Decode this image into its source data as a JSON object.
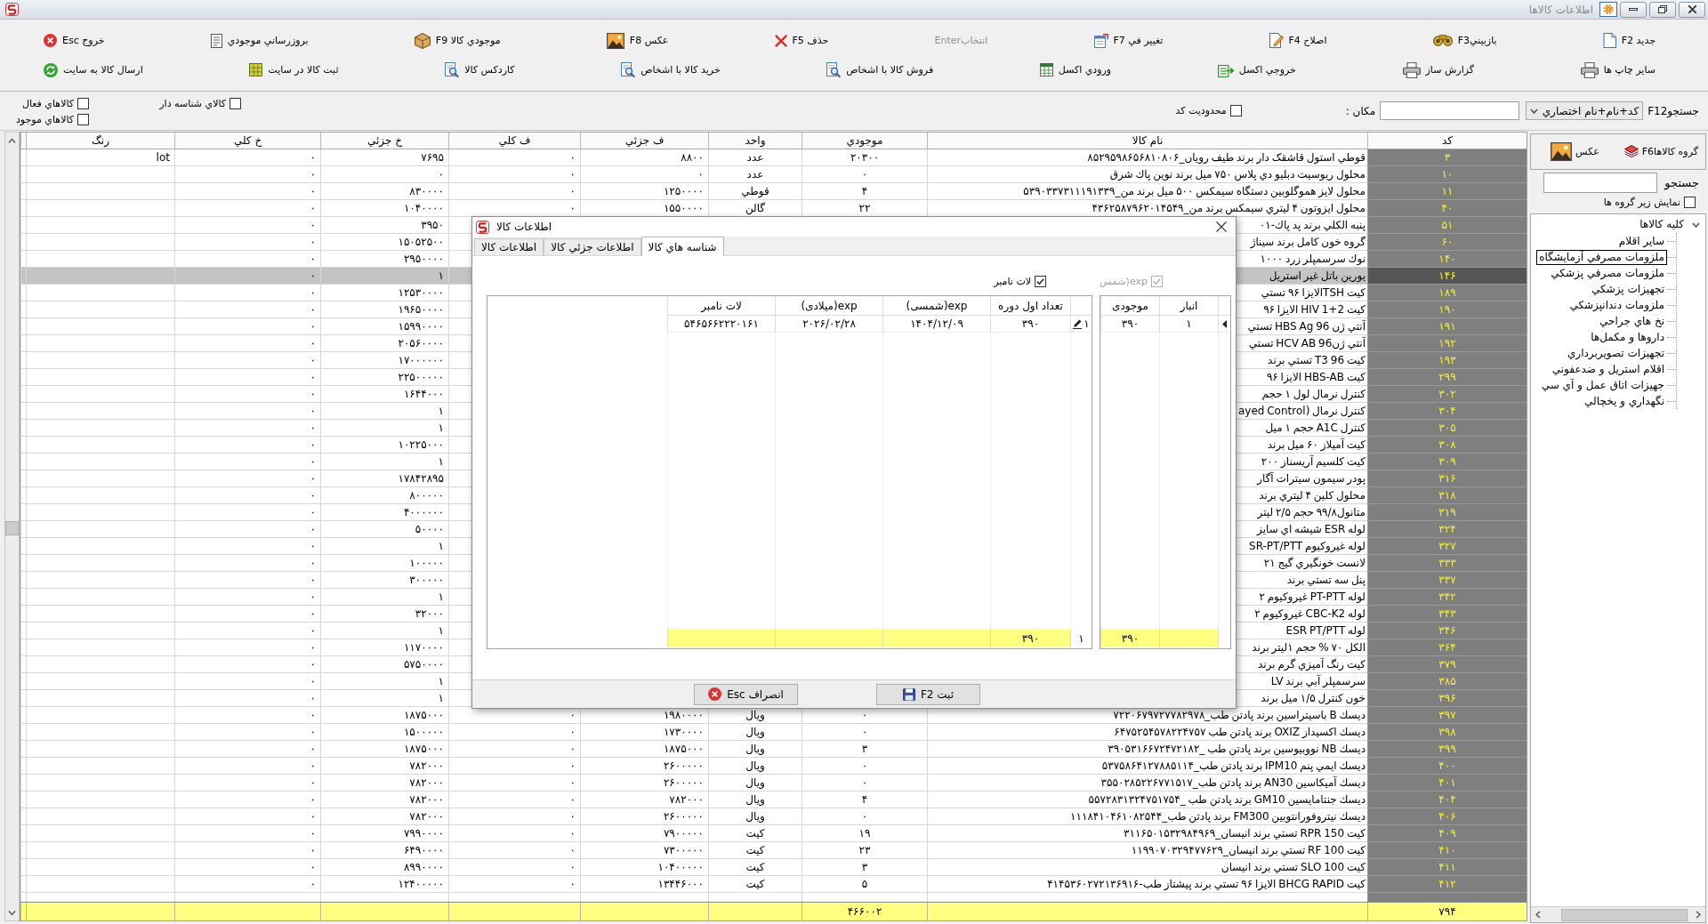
{
  "window": {
    "title": "اطلاعات كالاها"
  },
  "toolbar": {
    "top": [
      {
        "label": "جديد F2",
        "disabled": false
      },
      {
        "label": "بازبينيF3",
        "disabled": false
      },
      {
        "label": "اصلاح F4",
        "disabled": false
      },
      {
        "label": "تغيير في F7",
        "disabled": false
      },
      {
        "label": "انتخابEnter",
        "disabled": true
      },
      {
        "label": "حذف F5",
        "disabled": false
      },
      {
        "label": "عكس F8",
        "disabled": false
      },
      {
        "label": "موجودي كالا F9",
        "disabled": false
      },
      {
        "label": "بروزرساني موجودي",
        "disabled": false
      },
      {
        "label": "خروج Esc",
        "disabled": false
      }
    ],
    "bottom": [
      {
        "label": "ساير چاپ ها",
        "disabled": false
      },
      {
        "label": "گزارش ساز",
        "disabled": false
      },
      {
        "label": "خروجي اكسل",
        "disabled": false
      },
      {
        "label": "ورودي اكسل",
        "disabled": false
      },
      {
        "label": "فروش كالا با اشخاص",
        "disabled": false
      },
      {
        "label": "خريد كالا با اشخاص",
        "disabled": false
      },
      {
        "label": "كاردكس كالا",
        "disabled": false
      },
      {
        "label": "ثبت كالا در سايت",
        "disabled": false
      },
      {
        "label": "ارسال كالا به سايت",
        "disabled": false
      }
    ]
  },
  "filters": {
    "search_label": "جستجوF12",
    "search_mode": "كد+نام+نام اختصاري",
    "location_label": "مكان :",
    "code_limit": {
      "label": "محدوديت كد",
      "checked": false
    },
    "options": [
      {
        "label": "كالاي شناسه دار",
        "checked": false
      },
      {
        "label": "كالاهاي فعال",
        "checked": false
      },
      {
        "label": "كالاهاي موجود",
        "checked": false
      }
    ]
  },
  "table": {
    "columns": [
      "كد",
      "نام كالا",
      "موجودي",
      "واحد",
      "ف جزئي",
      "ف كلي",
      "خ جزئي",
      "خ كلي",
      "رنگ"
    ],
    "rows": [
      {
        "kod": "۳",
        "name": "قوطي استول قاشقک دار برند طيف رويان_۸۵۲۹۵۹۸۶۵۶۸۱۰۸۰۶",
        "stock": "۲۰۳۰۰",
        "unit": "عدد",
        "sell_retail": "۸۸۰۰",
        "sell_bulk": "۰",
        "buy_retail": "۷۶۹۵",
        "buy_bulk": "۰",
        "shade": "lot",
        "selected": false
      },
      {
        "kod": "۱۰",
        "name": "محلول ريوسيت دبليو دي پلاس  ۷۵۰ ميل برند نوين پاك شرق",
        "stock": "۰",
        "unit": "عدد",
        "sell_retail": "۰",
        "sell_bulk": "۰",
        "buy_retail": "۰",
        "buy_bulk": "۰",
        "selected": false
      },
      {
        "kod": "۱۱",
        "name": "محلول لايز هموگلوبين دستگاه سيمكس ۵۰۰ ميل برند من_۵۳۹۰۳۳۷۳۱۱۱۹۱۳۳۹",
        "stock": "۴",
        "unit": "قوطي",
        "sell_retail": "۱۲۵۰۰۰۰",
        "sell_bulk": "۰",
        "buy_retail": "۸۳۰۰۰۰",
        "buy_bulk": "۰",
        "selected": false
      },
      {
        "kod": "۴۰",
        "name": "محلول ايزوتون ۴ ليتري سيمكس برند من_۴۳۶۲۵۸۷۹۶۲۰۱۴۵۴۹",
        "stock": "۲۲",
        "unit": "گالن",
        "sell_retail": "۱۵۵۰۰۰۰",
        "sell_bulk": "۰",
        "buy_retail": "۱۰۴۰۰۰۰",
        "buy_bulk": "۰",
        "selected": false
      },
      {
        "kod": "۵۱",
        "name": "پنبه الكلي برند پد پاك-۰۱",
        "buy_retail": "۳۹۵۰",
        "buy_bulk": "۰",
        "selected": false
      },
      {
        "kod": "۶۰",
        "name": "گروه خون كامل برند سيناژ",
        "buy_retail": "۱۵۰۵۲۵۰۰",
        "buy_bulk": "۰",
        "selected": false
      },
      {
        "kod": "۱۴۰",
        "name": "نوك سرسمپلر زرد ۱۰۰۰",
        "buy_retail": "۲۹۵۰۰۰۰",
        "buy_bulk": "۰",
        "selected": false
      },
      {
        "kod": "۱۴۶",
        "name": "يورين باتل غير استريل",
        "buy_retail": "۱",
        "buy_bulk": "۰",
        "selected": true
      },
      {
        "kod": "۱۸۹",
        "name": "كيت TSHالايزا ۹۶ تستي",
        "buy_retail": "۱۲۵۳۰۰۰۰",
        "buy_bulk": "۰",
        "selected": false
      },
      {
        "kod": "۱۹۰",
        "name": "كيت HIV 1+2 الايزا ۹۶",
        "buy_retail": "۱۹۶۵۰۰۰۰",
        "buy_bulk": "۰",
        "selected": false
      },
      {
        "kod": "۱۹۱",
        "name": "آنتي ژن HBS Ag 96 تستي",
        "buy_retail": "۱۵۹۹۰۰۰۰",
        "buy_bulk": "۰",
        "selected": false
      },
      {
        "kod": "۱۹۲",
        "name": "آنتي ژنHCV AB 96 تستي",
        "buy_retail": "۲۰۵۶۰۰۰۰",
        "buy_bulk": "۰",
        "selected": false
      },
      {
        "kod": "۱۹۳",
        "name": "كيت T3 96 تستي برند",
        "buy_retail": "۱۷۰۰۰۰۰۰",
        "buy_bulk": "۰",
        "selected": false
      },
      {
        "kod": "۲۹۹",
        "name": "كيت HBS-AB الايزا ۹۶",
        "buy_retail": "۲۲۵۰۰۰۰۰",
        "buy_bulk": "۰",
        "selected": false
      },
      {
        "kod": "۳۰۲",
        "name": "كنترل نرمال لول ۱ حجم",
        "buy_retail": "۱۶۴۴۰۰۰",
        "buy_bulk": "۰",
        "selected": false
      },
      {
        "kod": "۳۰۴",
        "name": "كنترل نرمال (ayed Control",
        "buy_retail": "۱",
        "buy_bulk": "۰",
        "selected": false
      },
      {
        "kod": "۳۰۵",
        "name": "كنترل A1C حجم ۱ ميل",
        "buy_retail": "۱",
        "buy_bulk": "۰",
        "selected": false
      },
      {
        "kod": "۳۰۸",
        "name": "كيت آميلاز ۶۰ ميل برند",
        "buy_retail": "۱۰۲۲۵۰۰۰",
        "buy_bulk": "۰",
        "selected": false
      },
      {
        "kod": "۳۰۹",
        "name": "كيت كلسيم آريسناز ۲۰۰",
        "buy_retail": "۱",
        "buy_bulk": "۰",
        "selected": false
      },
      {
        "kod": "۳۱۶",
        "name": "پودر سيمون سيترات آگار",
        "buy_retail": "۱۷۸۴۲۸۹۵",
        "buy_bulk": "۰",
        "selected": false
      },
      {
        "kod": "۳۱۸",
        "name": "محلول كلين ۴ ليتري برند",
        "buy_retail": "۸۰۰۰۰۰",
        "buy_bulk": "۰",
        "selected": false
      },
      {
        "kod": "۳۱۹",
        "name": "متانول۹۹/۸ حجم ۲/۵ ليتر",
        "buy_retail": "۴۰۰۰۰۰۰",
        "buy_bulk": "۰",
        "selected": false
      },
      {
        "kod": "۳۲۴",
        "name": "لوله ESR شيشه اي سايز",
        "buy_retail": "۵۰۰۰۰",
        "buy_bulk": "۰",
        "selected": false
      },
      {
        "kod": "۳۲۷",
        "name": "لوله غيروكيوم SR-PT/PTT",
        "buy_retail": "۱",
        "buy_bulk": "۰",
        "selected": false
      },
      {
        "kod": "۳۳۳",
        "name": "لانست خونگيري گيج ۲۱",
        "buy_retail": "۱۰۰۰۰۰",
        "buy_bulk": "۰",
        "selected": false
      },
      {
        "kod": "۳۳۷",
        "name": "پنل سه تستي برند",
        "buy_retail": "۳۰۰۰۰۰",
        "buy_bulk": "۰",
        "selected": false
      },
      {
        "kod": "۳۴۲",
        "name": "لوله PT-PTT غيروكيوم ۲",
        "buy_retail": "۱",
        "buy_bulk": "۰",
        "selected": false
      },
      {
        "kod": "۳۴۳",
        "name": "لوله CBC-K2 غيروكيوم ۲",
        "buy_retail": "۳۲۰۰۰",
        "buy_bulk": "۰",
        "selected": false
      },
      {
        "kod": "۳۴۶",
        "name": "لوله ESR PT/PTT",
        "buy_retail": "۱",
        "buy_bulk": "۰",
        "selected": false
      },
      {
        "kod": "۳۶۴",
        "name": "الكل ۷۰ % حجم ۱ليتر برند",
        "buy_retail": "۱۱۷۰۰۰۰",
        "buy_bulk": "۰",
        "selected": false
      },
      {
        "kod": "۳۷۹",
        "name": "كيت رنگ آميزي گرم برند",
        "buy_retail": "۵۷۵۰۰۰۰",
        "buy_bulk": "۰",
        "selected": false
      },
      {
        "kod": "۳۸۵",
        "name": "سرسمپلر آبي برند LV",
        "buy_retail": "۱",
        "buy_bulk": "۰",
        "selected": false
      },
      {
        "kod": "۳۹۶",
        "name": "خون كنترل ۱/۵ ميل برند",
        "buy_retail": "۱",
        "buy_bulk": "۰",
        "selected": false
      },
      {
        "kod": "۳۹۷",
        "name": "ديسك B باسيتراسين برند پادتن طب_۷۲۲۰۶۷۹۷۲۷۷۸۲۹۷۸",
        "stock": "۰",
        "unit": "ويال",
        "sell_retail": "۱۹۸۰۰۰۰",
        "sell_bulk": "۰",
        "buy_retail": "۱۸۷۵۰۰۰",
        "buy_bulk": "۰",
        "selected": false
      },
      {
        "kod": "۳۹۸",
        "name": "ديسك اكسيداز OXIZ  برند پادتن طب ۶۴۷۵۲۵۴۵۷۸۲۲۴۷۵۷",
        "stock": "۰",
        "unit": "ويال",
        "sell_retail": "۱۷۳۰۰۰۰",
        "sell_bulk": "۰",
        "buy_retail": "۱۵۰۰۰۰۰",
        "buy_bulk": "۰",
        "selected": false
      },
      {
        "kod": "۳۹۹",
        "name": "ديسك NB نووبيوسين برند پادتن طب _۳۹۰۵۳۱۶۶۷۲۴۷۲۱۸۲",
        "stock": "۳",
        "unit": "ويال",
        "sell_retail": "۱۸۷۵۰۰۰",
        "sell_bulk": "۰",
        "buy_retail": "۱۸۷۵۰۰۰",
        "buy_bulk": "۰",
        "selected": false
      },
      {
        "kod": "۴۰۰",
        "name": "ديسك ايمي پنم IPM10  برند پادتن طب_۵۳۷۵۸۶۴۱۲۷۸۸۵۱۱۴",
        "stock": "۰",
        "unit": "ويال",
        "sell_retail": "۲۶۰۰۰۰۰",
        "sell_bulk": "۰",
        "buy_retail": "۷۸۲۰۰۰",
        "buy_bulk": "۰",
        "selected": false
      },
      {
        "kod": "۴۰۱",
        "name": "ديسك آميكاسين AN30  برند پادتن طب_۳۵۵۰۲۸۵۲۲۶۷۷۱۵۱۷",
        "stock": "۰",
        "unit": "ويال",
        "sell_retail": "۲۶۰۰۰۰۰",
        "sell_bulk": "۰",
        "buy_retail": "۷۸۲۰۰۰",
        "buy_bulk": "۰",
        "selected": false
      },
      {
        "kod": "۴۰۴",
        "name": "ديسك جنتامايسين GM10  برند پادتن طب _۵۵۷۲۸۳۱۳۲۴۷۵۱۷۵۴",
        "stock": "۴",
        "unit": "ويال",
        "sell_retail": "۷۸۲۰۰۰",
        "sell_bulk": "۰",
        "buy_retail": "۷۸۲۰۰۰",
        "buy_bulk": "۰",
        "selected": false
      },
      {
        "kod": "۴۰۶",
        "name": "ديسك نيتروفورانتوبين FM300  برند پادتن طب_۱۱۱۸۴۱۰۴۶۱۰۸۲۵۴۴",
        "stock": "۰",
        "unit": "ويال",
        "sell_retail": "۲۶۰۰۰۰۰",
        "sell_bulk": "۰",
        "buy_retail": "۷۸۲۰۰۰",
        "buy_bulk": "۰",
        "selected": false
      },
      {
        "kod": "۴۰۹",
        "name": "كيت RPR 150 تستي برند انيسان_۳۱۱۶۵۰۱۵۳۲۹۸۴۹۶۹",
        "stock": "۱۹",
        "unit": "كيت",
        "sell_retail": "۷۹۰۰۰۰۰",
        "sell_bulk": "۰",
        "buy_retail": "۷۹۹۰۰۰۰",
        "buy_bulk": "۰",
        "selected": false
      },
      {
        "kod": "۴۱۰",
        "name": "كيت RF 100 تستي برند انيسان_۱۱۹۹۰۷۰۳۲۹۴۷۷۶۲۹",
        "stock": "۲۳",
        "unit": "كيت",
        "sell_retail": "۷۳۰۰۰۰۰",
        "sell_bulk": "۰",
        "buy_retail": "۶۴۹۰۰۰۰",
        "buy_bulk": "۰",
        "selected": false
      },
      {
        "kod": "۴۱۱",
        "name": "كيت SLO 100 تستي برند انيسان",
        "stock": "۳",
        "unit": "كيت",
        "sell_retail": "۱۰۴۰۰۰۰۰",
        "sell_bulk": "۰",
        "buy_retail": "۸۹۹۰۰۰۰",
        "buy_bulk": "۰",
        "selected": false
      },
      {
        "kod": "۴۱۲",
        "name": "كيت BHCG RAPID الايزا ۹۶ تستي برند پيشتاز طب-۴۱۴۵۳۶۰۲۷۲۱۳۶۹۱۶",
        "stock": "۵",
        "unit": "كيت",
        "sell_retail": "۱۳۴۴۶۰۰۰",
        "sell_bulk": "۰",
        "buy_retail": "۱۲۴۰۰۰۰۰",
        "buy_bulk": "۰",
        "selected": false
      }
    ],
    "totals": {
      "kod": "۷۹۴",
      "stock": "۴۶۶۰۰۲"
    }
  },
  "side_panel": {
    "buttons": [
      {
        "label": "گروه كالاهاF6",
        "kind": "groups"
      },
      {
        "label": "عكس",
        "kind": "photo"
      }
    ],
    "search_label": "جستجو",
    "show_subgroups": {
      "label": "نمايش زير گروه ها",
      "checked": false
    },
    "tree": {
      "label": "كليه كالاها",
      "expanded": true,
      "selected": false,
      "children": [
        {
          "label": "ساير اقلام",
          "selected": false
        },
        {
          "label": "ملزومات مصرفي آزمايشگاه",
          "selected": true
        },
        {
          "label": "ملزومات مصرفي پزشكي",
          "selected": false
        },
        {
          "label": "تجهيزات پزشكي",
          "selected": false
        },
        {
          "label": "ملزومات دندانپزشكي",
          "selected": false
        },
        {
          "label": "نخ هاي جراحي",
          "selected": false
        },
        {
          "label": "داروها و مكمل‌ها",
          "selected": false
        },
        {
          "label": "تجهيزات تصويربرداري",
          "selected": false
        },
        {
          "label": "اقلام استريل و ضدعفوني",
          "selected": false
        },
        {
          "label": "جهيزات اتاق عمل و آي سي",
          "selected": false
        },
        {
          "label": "نگهداري و يخچالي",
          "selected": false
        }
      ]
    }
  },
  "dialog": {
    "title": "اطلاعات كالا",
    "tabs": [
      {
        "label": "شناسه هاي كالا",
        "selected": true
      },
      {
        "label": "اطلاعات جزئي كالا",
        "selected": false
      },
      {
        "label": "اطلاعات كالا",
        "selected": false
      }
    ],
    "options": [
      {
        "label": "exp(شمس",
        "checked": true,
        "disabled": true
      },
      {
        "label": "لات نامبر",
        "checked": true,
        "disabled": false
      }
    ],
    "lot_grid": {
      "columns": [
        "تعداد اول دوره",
        "exp(شمسی)",
        "exp(ميلادی)",
        "لات نامبر"
      ],
      "rows": [
        {
          "number": "۱",
          "editing": true,
          "cells": [
            "۳۹۰",
            "۱۴۰۴/۱۲/۰۹",
            "۲۰۲۶/۰۲/۲۸",
            "۵۴۶۵۶۶۲۲۲۰۱۶۱"
          ]
        }
      ],
      "totals": {
        "count": "۱",
        "quantity": "۳۹۰"
      }
    },
    "stock_grid": {
      "columns": [
        "انبار",
        "موجودی"
      ],
      "rows": [
        {
          "current": true,
          "cells": [
            "۱",
            "۳۹۰"
          ]
        }
      ],
      "totals": {
        "stock": "۳۹۰"
      }
    },
    "buttons": [
      {
        "label": "ثبت F2",
        "kind": "save"
      },
      {
        "label": "انصراف Esc",
        "kind": "cancel"
      }
    ]
  }
}
